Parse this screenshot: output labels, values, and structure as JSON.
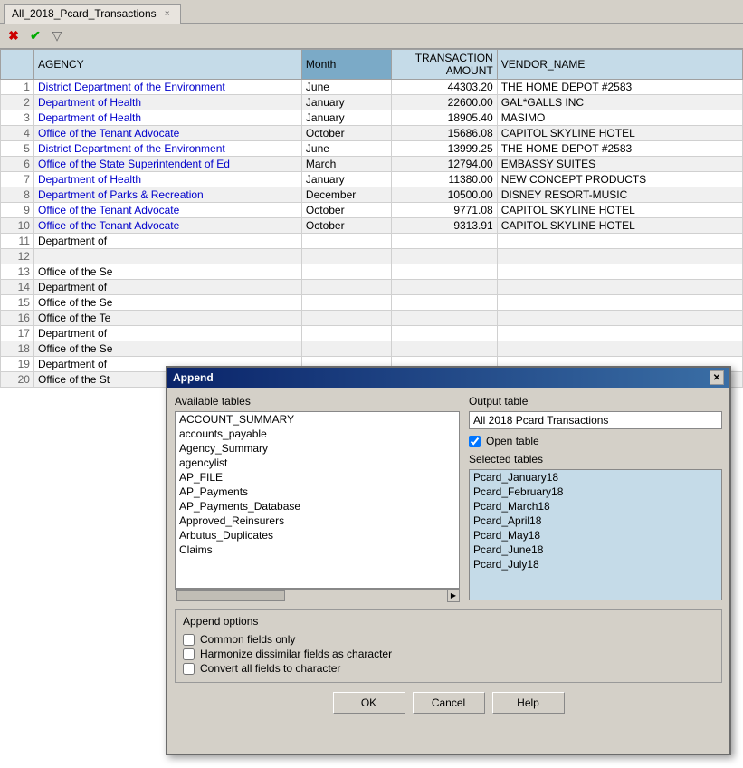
{
  "tab": {
    "label": "All_2018_Pcard_Transactions",
    "close": "×"
  },
  "toolbar": {
    "buttons": [
      "✖",
      "✔",
      "▽"
    ]
  },
  "table": {
    "headers": [
      {
        "label": "",
        "class": "col-row-num"
      },
      {
        "label": "AGENCY",
        "class": "col-agency"
      },
      {
        "label": "Month",
        "class": "col-month sorted"
      },
      {
        "label": "TRANSACTION\nAMOUNT",
        "class": "col-amount"
      },
      {
        "label": "VENDOR_NAME",
        "class": "col-vendor"
      }
    ],
    "rows": [
      {
        "num": "1",
        "agency": "District Department of the Environment",
        "month": "June",
        "amount": "44303.20",
        "vendor": "THE HOME DEPOT #2583"
      },
      {
        "num": "2",
        "agency": "Department of Health",
        "month": "January",
        "amount": "22600.00",
        "vendor": "GAL*GALLS INC"
      },
      {
        "num": "3",
        "agency": "Department of Health",
        "month": "January",
        "amount": "18905.40",
        "vendor": "MASIMO"
      },
      {
        "num": "4",
        "agency": "Office of the Tenant Advocate",
        "month": "October",
        "amount": "15686.08",
        "vendor": "CAPITOL SKYLINE HOTEL"
      },
      {
        "num": "5",
        "agency": "District Department of the Environment",
        "month": "June",
        "amount": "13999.25",
        "vendor": "THE HOME DEPOT #2583"
      },
      {
        "num": "6",
        "agency": "Office of the State Superintendent of Ed",
        "month": "March",
        "amount": "12794.00",
        "vendor": "EMBASSY SUITES"
      },
      {
        "num": "7",
        "agency": "Department of Health",
        "month": "January",
        "amount": "11380.00",
        "vendor": "NEW CONCEPT PRODUCTS"
      },
      {
        "num": "8",
        "agency": "Department of Parks & Recreation",
        "month": "December",
        "amount": "10500.00",
        "vendor": "DISNEY RESORT-MUSIC"
      },
      {
        "num": "9",
        "agency": "Office of the Tenant Advocate",
        "month": "October",
        "amount": "9771.08",
        "vendor": "CAPITOL SKYLINE HOTEL"
      },
      {
        "num": "10",
        "agency": "Office of the Tenant Advocate",
        "month": "October",
        "amount": "9313.91",
        "vendor": "CAPITOL SKYLINE HOTEL"
      },
      {
        "num": "11",
        "agency": "Department of",
        "month": "",
        "amount": "",
        "vendor": ""
      },
      {
        "num": "12",
        "agency": "",
        "month": "",
        "amount": "",
        "vendor": ""
      },
      {
        "num": "13",
        "agency": "Office of the Se",
        "month": "",
        "amount": "",
        "vendor": ""
      },
      {
        "num": "14",
        "agency": "Department of",
        "month": "",
        "amount": "",
        "vendor": ""
      },
      {
        "num": "15",
        "agency": "Office of the Se",
        "month": "",
        "amount": "",
        "vendor": ""
      },
      {
        "num": "16",
        "agency": "Office of the Te",
        "month": "",
        "amount": "",
        "vendor": ""
      },
      {
        "num": "17",
        "agency": "Department of",
        "month": "",
        "amount": "",
        "vendor": ""
      },
      {
        "num": "18",
        "agency": "Office of the Se",
        "month": "",
        "amount": "",
        "vendor": ""
      },
      {
        "num": "19",
        "agency": "Department of",
        "month": "",
        "amount": "",
        "vendor": ""
      },
      {
        "num": "20",
        "agency": "Office of the St",
        "month": "",
        "amount": "",
        "vendor": ""
      }
    ]
  },
  "dialog": {
    "title": "Append",
    "close_btn": "✕",
    "available_tables_label": "Available tables",
    "available_tables": [
      "ACCOUNT_SUMMARY",
      "accounts_payable",
      "Agency_Summary",
      "agencylist",
      "AP_FILE",
      "AP_Payments",
      "AP_Payments_Database",
      "Approved_Reinsurers",
      "Arbutus_Duplicates",
      "Claims"
    ],
    "output_table_label": "Output table",
    "output_table_value": "All 2018 Pcard Transactions",
    "open_table_label": "Open table",
    "open_table_checked": true,
    "selected_tables_label": "Selected tables",
    "selected_tables": [
      "Pcard_January18",
      "Pcard_February18",
      "Pcard_March18",
      "Pcard_April18",
      "Pcard_May18",
      "Pcard_June18",
      "Pcard_July18"
    ],
    "append_options_label": "Append options",
    "options": [
      {
        "label": "Common fields only",
        "checked": false
      },
      {
        "label": "Harmonize dissimilar fields as character",
        "checked": false
      },
      {
        "label": "Convert all fields to character",
        "checked": false
      }
    ],
    "buttons": {
      "ok": "OK",
      "cancel": "Cancel",
      "help": "Help"
    }
  }
}
